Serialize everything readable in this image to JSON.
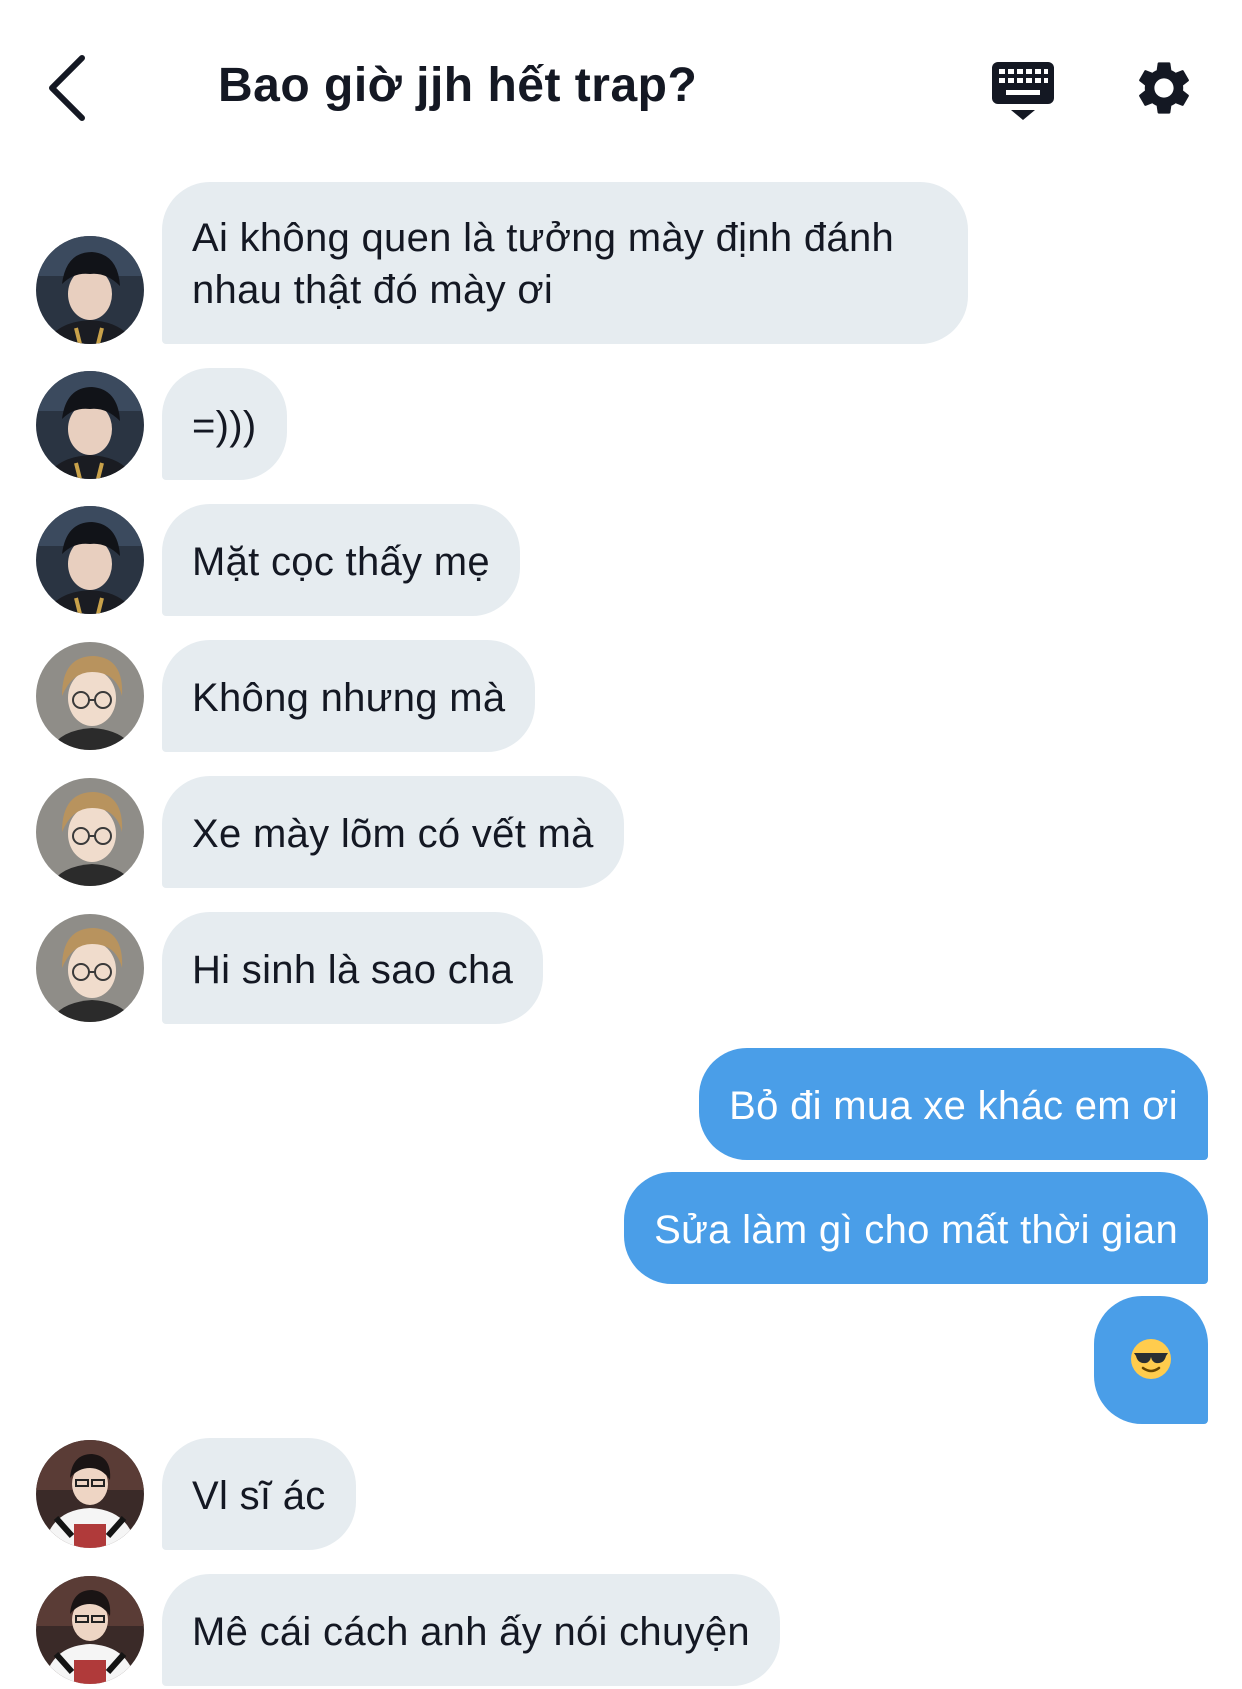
{
  "header": {
    "title": "Bao giờ jjh hết trap?",
    "icons": {
      "back": "chevron-left-icon",
      "keyboard": "keyboard-icon",
      "settings": "gear-icon"
    }
  },
  "colors": {
    "incoming_bubble": "#e6ecf0",
    "outgoing_bubble": "#4a9ee8",
    "text": "#141823",
    "outgoing_text": "#ffffff"
  },
  "messages": [
    {
      "sender": "A",
      "direction": "incoming",
      "text": "Ai không quen là tưởng mày định đánh nhau thật đó mày ơi"
    },
    {
      "sender": "A",
      "direction": "incoming",
      "text": "=)))"
    },
    {
      "sender": "A",
      "direction": "incoming",
      "text": "Mặt cọc thấy mẹ"
    },
    {
      "sender": "B",
      "direction": "incoming",
      "text": "Không nhưng mà"
    },
    {
      "sender": "B",
      "direction": "incoming",
      "text": "Xe mày lõm có vết mà"
    },
    {
      "sender": "B",
      "direction": "incoming",
      "text": "Hi sinh là sao cha"
    },
    {
      "sender": "me",
      "direction": "outgoing",
      "text": "Bỏ đi mua xe khác em ơi"
    },
    {
      "sender": "me",
      "direction": "outgoing",
      "text": "Sửa làm gì cho mất thời gian"
    },
    {
      "sender": "me",
      "direction": "outgoing",
      "emoji": "sunglasses-emoji"
    },
    {
      "sender": "C",
      "direction": "incoming",
      "text": "Vl sĩ ác"
    },
    {
      "sender": "C",
      "direction": "incoming",
      "text": "Mê cái cách anh ấy nói chuyện"
    }
  ]
}
